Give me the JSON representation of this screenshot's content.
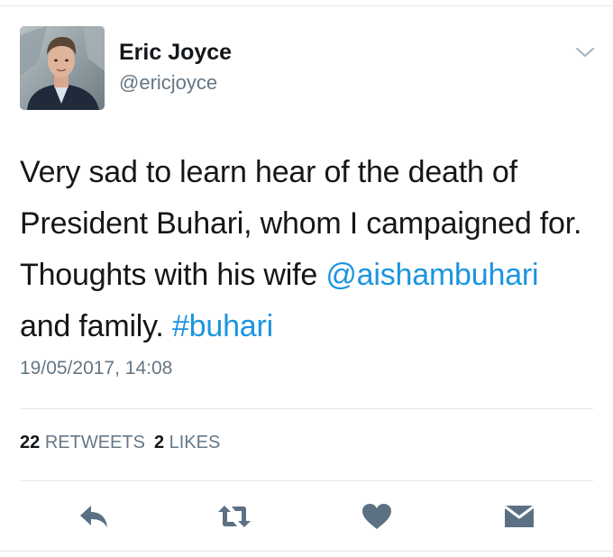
{
  "author": {
    "name": "Eric Joyce",
    "handle": "@ericjoyce"
  },
  "tweet": {
    "text_before": "Very sad to learn hear of the death of President Buhari, whom I campaigned for. Thoughts with his wife ",
    "mention": "@aishambuhari",
    "text_middle": " and family. ",
    "hashtag": "#buhari",
    "timestamp": "19/05/2017, 14:08"
  },
  "stats": {
    "retweets_count": "22",
    "retweets_label": "RETWEETS",
    "likes_count": "2",
    "likes_label": "LIKES"
  },
  "colors": {
    "link": "#1b95e0",
    "secondary_text": "#657786",
    "action_icon": "#5b7083",
    "divider": "#e1e8ed"
  },
  "icons": {
    "more": "chevron-down-icon",
    "reply": "reply-icon",
    "retweet": "retweet-icon",
    "like": "heart-icon",
    "dm": "envelope-icon"
  }
}
